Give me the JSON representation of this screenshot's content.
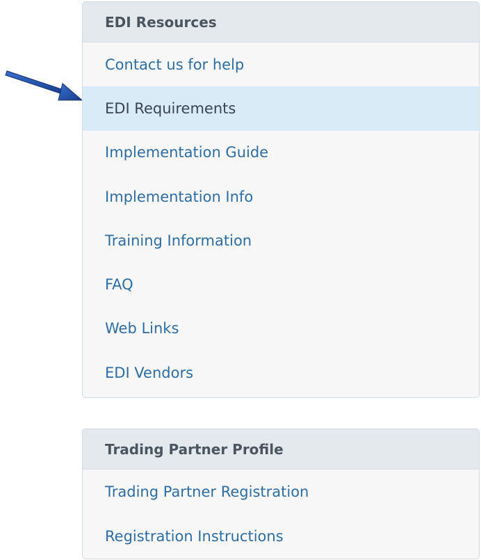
{
  "edi_resources": {
    "title": "EDI Resources",
    "items": [
      {
        "label": "Contact us for help"
      },
      {
        "label": "EDI Requirements",
        "active": true
      },
      {
        "label": "Implementation Guide"
      },
      {
        "label": "Implementation Info"
      },
      {
        "label": "Training Information"
      },
      {
        "label": "FAQ"
      },
      {
        "label": "Web Links"
      },
      {
        "label": "EDI Vendors"
      }
    ]
  },
  "trading_partner_profile": {
    "title": "Trading Partner Profile",
    "items": [
      {
        "label": "Trading Partner Registration"
      },
      {
        "label": "Registration Instructions"
      }
    ]
  },
  "colors": {
    "link": "#2d6da3",
    "active_bg": "#d9ebf6",
    "header_bg": "#e4e9ee",
    "arrow": "#1f4fa8"
  }
}
